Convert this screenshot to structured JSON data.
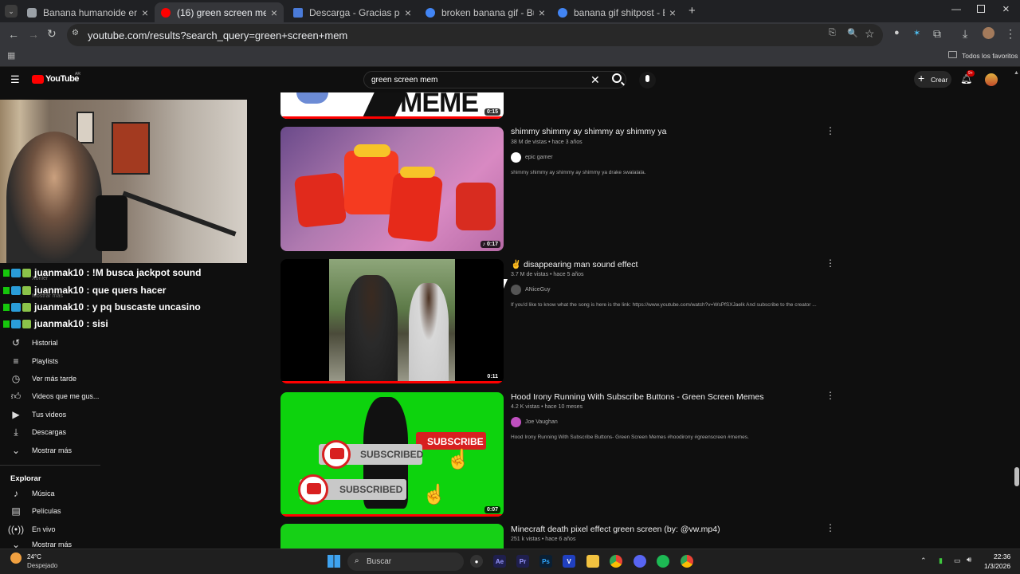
{
  "browser": {
    "tabs": [
      {
        "title": "Banana humanoide en foto",
        "color": "#9aa0a6"
      },
      {
        "title": "(16) green screen mem - YouTube",
        "color": "#ff0000"
      },
      {
        "title": "Descarga - Gracias por descargar",
        "color": "#4a7bd9"
      },
      {
        "title": "broken banana gif - Buscar con G",
        "color": "#4285f4"
      },
      {
        "title": "banana gif shitpost - Buscar con G",
        "color": "#4285f4"
      }
    ],
    "url": "youtube.com/results?search_query=green+screen+mem",
    "bookmarks_all": "Todos los favoritos"
  },
  "youtube": {
    "logo": "YouTube",
    "country": "AR",
    "search_value": "green screen mem",
    "create_label": "Crear",
    "notif_count": "9+"
  },
  "chat": [
    {
      "user": "juanmak10",
      "msg": ": !M busca jackpot sound"
    },
    {
      "user": "juanmak10",
      "msg": ": que quers hacer"
    },
    {
      "user": "juanmak10",
      "msg": ": y pq buscaste uncasino"
    },
    {
      "user": "juanmak10",
      "msg": ": sisi"
    }
  ],
  "sidebar": {
    "hidden1": "Xonler",
    "hidden2": "Mostrar más",
    "items": [
      {
        "label": "Historial",
        "icon": "history-icon"
      },
      {
        "label": "Playlists",
        "icon": "playlist-icon"
      },
      {
        "label": "Ver más tarde",
        "icon": "clock-icon"
      },
      {
        "label": "Videos que me gus...",
        "icon": "like-icon"
      },
      {
        "label": "Tus videos",
        "icon": "video-icon"
      },
      {
        "label": "Descargas",
        "icon": "download-icon"
      },
      {
        "label": "Mostrar más",
        "icon": "chevron-down-icon"
      }
    ],
    "explore_heading": "Explorar",
    "explore": [
      {
        "label": "Música",
        "icon": "music-icon"
      },
      {
        "label": "Películas",
        "icon": "film-icon"
      },
      {
        "label": "En vivo",
        "icon": "live-icon"
      },
      {
        "label": "Mostrar más",
        "icon": "chevron-down-icon"
      }
    ]
  },
  "results": [
    {
      "duration": "0:15",
      "thumb_text": "MEME"
    },
    {
      "title": "shimmy shimmy ay shimmy ay shimmy ya",
      "meta": "38 M de vistas • hace 3 años",
      "channel": "epic gamer",
      "desc": "shimmy shimmy ay shimmy ay shimmy ya drake swalalala.",
      "duration": "0:17",
      "duration_icon": "♪"
    },
    {
      "title_emoji": "✌",
      "title": "disappearing man sound effect",
      "meta": "3.7 M de vistas • hace 5 años",
      "channel": "ANiceGuy",
      "desc": "If you'd like to know what the song is here is the link: https://www.youtube.com/watch?v=WsPfSXJaelk And subscribe to the creator ...",
      "duration": "0:11"
    },
    {
      "title": "Hood Irony Running With Subscribe Buttons - Green Screen Memes",
      "meta": "4.2 K vistas • hace 10 meses",
      "channel": "Joe Vaughan",
      "desc": "Hood Irony Running With Subscribe Buttons- Green Screen Memes #hoodirony #greenscreen #memes.",
      "duration": "0:07",
      "btn_subscribe": "SUBSCRIBE",
      "btn_subscribed": "SUBSCRIBED"
    },
    {
      "title": "Minecraft death pixel effect green screen (by: @vw.mp4)",
      "meta": "251 k vistas • hace 6 años"
    }
  ],
  "taskbar": {
    "weather_temp": "24°C",
    "weather_desc": "Despejado",
    "search": "Buscar",
    "time": "22:36",
    "date": "1/3/2026"
  }
}
